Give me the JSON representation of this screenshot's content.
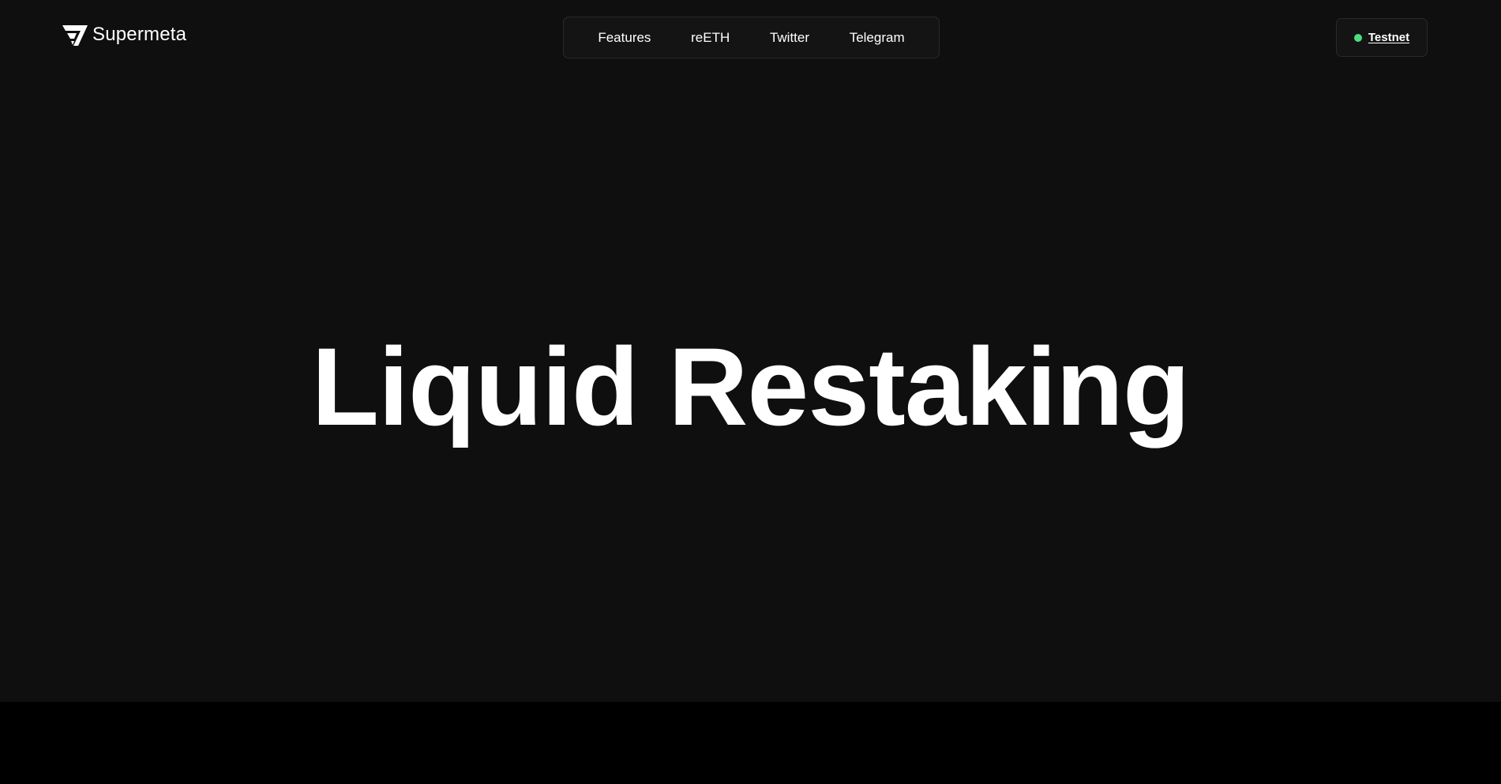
{
  "brand": {
    "name": "Supermeta",
    "icon": "supermeta-logo-icon"
  },
  "nav": {
    "items": [
      {
        "label": "Features"
      },
      {
        "label": "reETH"
      },
      {
        "label": "Twitter"
      },
      {
        "label": "Telegram"
      }
    ]
  },
  "network": {
    "label": "Testnet",
    "status_color": "#4ade80"
  },
  "hero": {
    "title": "Liquid Restaking"
  },
  "colors": {
    "background": "#0f0f0f",
    "bottom_band": "#000000",
    "text": "#ffffff",
    "border": "#2a2a2a"
  }
}
